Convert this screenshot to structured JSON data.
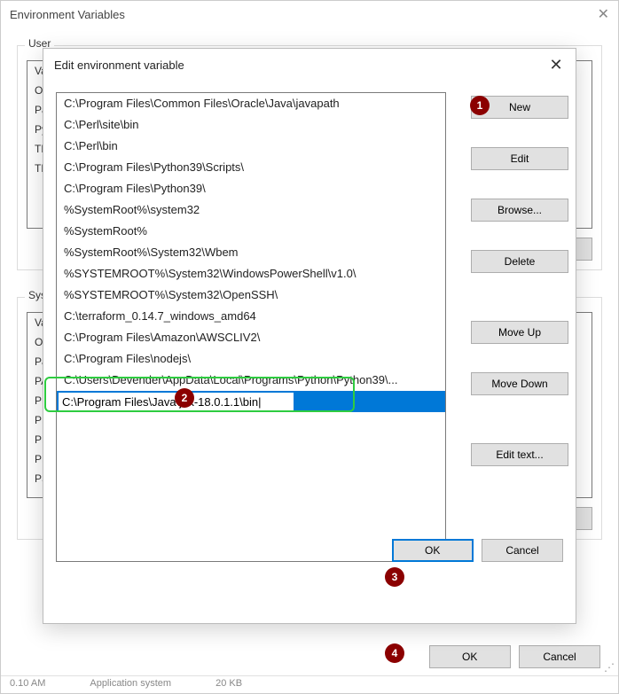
{
  "parent": {
    "title": "Environment Variables",
    "user_legend": "User",
    "sys_legend": "Syste",
    "user_rows": [
      "Va",
      "Or",
      "Pa",
      "Py",
      "TE",
      "TN"
    ],
    "sys_rows": [
      "Va",
      "OS",
      "Pa",
      "PA",
      "PR",
      "PR",
      "PR",
      "PR",
      "PS"
    ],
    "ok": "OK",
    "cancel": "Cancel"
  },
  "child": {
    "title": "Edit environment variable",
    "paths": [
      "C:\\Program Files\\Common Files\\Oracle\\Java\\javapath",
      "C:\\Perl\\site\\bin",
      "C:\\Perl\\bin",
      "C:\\Program Files\\Python39\\Scripts\\",
      "C:\\Program Files\\Python39\\",
      "%SystemRoot%\\system32",
      "%SystemRoot%",
      "%SystemRoot%\\System32\\Wbem",
      "%SYSTEMROOT%\\System32\\WindowsPowerShell\\v1.0\\",
      "%SYSTEMROOT%\\System32\\OpenSSH\\",
      "C:\\terraform_0.14.7_windows_amd64",
      "C:\\Program Files\\Amazon\\AWSCLIV2\\",
      "C:\\Program Files\\nodejs\\",
      "C:\\Users\\Devender\\AppData\\Local\\Programs\\Python\\Python39\\..."
    ],
    "edit_value": "C:\\Program Files\\Java\\jdk-18.0.1.1\\bin|",
    "buttons": {
      "new": "New",
      "edit": "Edit",
      "browse": "Browse...",
      "delete": "Delete",
      "move_up": "Move Up",
      "move_down": "Move Down",
      "edit_text": "Edit text...",
      "ok": "OK",
      "cancel": "Cancel"
    }
  },
  "badges": {
    "n1": "1",
    "n2": "2",
    "n3": "3",
    "n4": "4"
  },
  "statusbar": {
    "time": "0.10 AM",
    "type": "Application system",
    "size": "20 KB"
  },
  "resize_grip_glyph": "⋰"
}
